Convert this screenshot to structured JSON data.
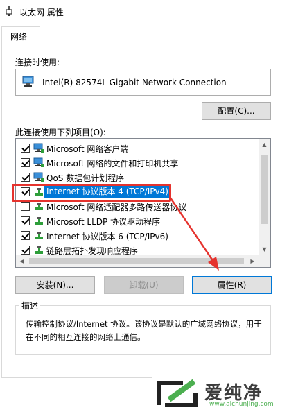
{
  "window": {
    "title": "以太网 属性"
  },
  "tabs": [
    {
      "label": "网络"
    }
  ],
  "connection": {
    "label": "连接时使用:",
    "adapter_name": "Intel(R) 82574L Gigabit Network Connection",
    "configure_button": "配置(C)..."
  },
  "items_section": {
    "label": "此连接使用下列项目(O):",
    "items": [
      {
        "label": "Microsoft 网络客户端",
        "checked": true,
        "icon": "network-client-icon"
      },
      {
        "label": "Microsoft 网络的文件和打印机共享",
        "checked": true,
        "icon": "network-share-icon"
      },
      {
        "label": "QoS 数据包计划程序",
        "checked": true,
        "icon": "qos-icon"
      },
      {
        "label": "Internet 协议版本 4 (TCP/IPv4)",
        "checked": true,
        "selected": true,
        "icon": "protocol-icon"
      },
      {
        "label": "Microsoft 网络适配器多路传送器协议",
        "checked": false,
        "icon": "protocol-icon"
      },
      {
        "label": "Microsoft LLDP 协议驱动程序",
        "checked": true,
        "icon": "protocol-icon"
      },
      {
        "label": "Internet 协议版本 6 (TCP/IPv6)",
        "checked": true,
        "icon": "protocol-icon"
      },
      {
        "label": "链路层拓扑发现响应程序",
        "checked": true,
        "icon": "protocol-icon"
      }
    ]
  },
  "buttons": {
    "install": "安装(N)...",
    "uninstall": "卸载(U)",
    "properties": "属性(R)"
  },
  "description": {
    "legend": "描述",
    "text": "传输控制协议/Internet 协议。该协议是默认的广域网络协议，用于在不同的相互连接的网络上通信。"
  },
  "watermark": {
    "text": "爱纯净",
    "url": "www.aichunjing.com"
  },
  "colors": {
    "selection": "#0078d7",
    "highlight": "#e5322d",
    "watermark_green": "#4caf50"
  }
}
